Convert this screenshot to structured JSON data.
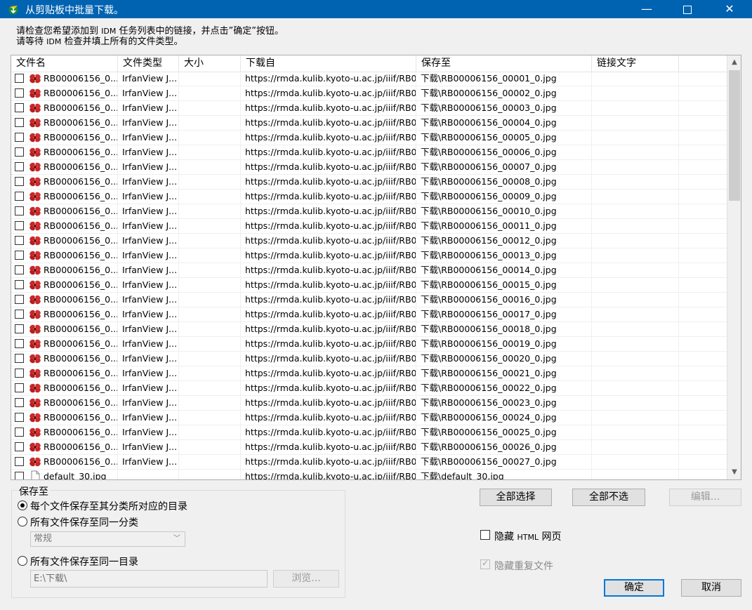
{
  "window": {
    "title": "从剪贴板中批量下载。",
    "minimize_glyph": "—",
    "close_glyph": "✕"
  },
  "instructions": {
    "line1_prefix": "请检查您希望添加到 ",
    "line1_idm": "IDM",
    "line1_suffix": " 任务列表中的链接，并点击”确定”按钮。",
    "line2_prefix": "请等待 ",
    "line2_idm": "IDM",
    "line2_suffix": " 检查并填上所有的文件类型。"
  },
  "table": {
    "columns": [
      "文件名",
      "文件类型",
      "大小",
      "下载自",
      "保存至",
      "链接文字"
    ],
    "rows": [
      {
        "name": "RB00006156_0...",
        "type": "IrfanView J...",
        "url": "https://rmda.kulib.kyoto-u.ac.jp/iiif/RB0...",
        "save": "下载\\RB00006156_00001_0.jpg"
      },
      {
        "name": "RB00006156_0...",
        "type": "IrfanView J...",
        "url": "https://rmda.kulib.kyoto-u.ac.jp/iiif/RB0...",
        "save": "下载\\RB00006156_00002_0.jpg"
      },
      {
        "name": "RB00006156_0...",
        "type": "IrfanView J...",
        "url": "https://rmda.kulib.kyoto-u.ac.jp/iiif/RB0...",
        "save": "下载\\RB00006156_00003_0.jpg"
      },
      {
        "name": "RB00006156_0...",
        "type": "IrfanView J...",
        "url": "https://rmda.kulib.kyoto-u.ac.jp/iiif/RB0...",
        "save": "下载\\RB00006156_00004_0.jpg"
      },
      {
        "name": "RB00006156_0...",
        "type": "IrfanView J...",
        "url": "https://rmda.kulib.kyoto-u.ac.jp/iiif/RB0...",
        "save": "下载\\RB00006156_00005_0.jpg"
      },
      {
        "name": "RB00006156_0...",
        "type": "IrfanView J...",
        "url": "https://rmda.kulib.kyoto-u.ac.jp/iiif/RB0...",
        "save": "下载\\RB00006156_00006_0.jpg"
      },
      {
        "name": "RB00006156_0...",
        "type": "IrfanView J...",
        "url": "https://rmda.kulib.kyoto-u.ac.jp/iiif/RB0...",
        "save": "下载\\RB00006156_00007_0.jpg"
      },
      {
        "name": "RB00006156_0...",
        "type": "IrfanView J...",
        "url": "https://rmda.kulib.kyoto-u.ac.jp/iiif/RB0...",
        "save": "下载\\RB00006156_00008_0.jpg"
      },
      {
        "name": "RB00006156_0...",
        "type": "IrfanView J...",
        "url": "https://rmda.kulib.kyoto-u.ac.jp/iiif/RB0...",
        "save": "下载\\RB00006156_00009_0.jpg"
      },
      {
        "name": "RB00006156_0...",
        "type": "IrfanView J...",
        "url": "https://rmda.kulib.kyoto-u.ac.jp/iiif/RB0...",
        "save": "下载\\RB00006156_00010_0.jpg"
      },
      {
        "name": "RB00006156_0...",
        "type": "IrfanView J...",
        "url": "https://rmda.kulib.kyoto-u.ac.jp/iiif/RB0...",
        "save": "下载\\RB00006156_00011_0.jpg"
      },
      {
        "name": "RB00006156_0...",
        "type": "IrfanView J...",
        "url": "https://rmda.kulib.kyoto-u.ac.jp/iiif/RB0...",
        "save": "下载\\RB00006156_00012_0.jpg"
      },
      {
        "name": "RB00006156_0...",
        "type": "IrfanView J...",
        "url": "https://rmda.kulib.kyoto-u.ac.jp/iiif/RB0...",
        "save": "下载\\RB00006156_00013_0.jpg"
      },
      {
        "name": "RB00006156_0...",
        "type": "IrfanView J...",
        "url": "https://rmda.kulib.kyoto-u.ac.jp/iiif/RB0...",
        "save": "下载\\RB00006156_00014_0.jpg"
      },
      {
        "name": "RB00006156_0...",
        "type": "IrfanView J...",
        "url": "https://rmda.kulib.kyoto-u.ac.jp/iiif/RB0...",
        "save": "下载\\RB00006156_00015_0.jpg"
      },
      {
        "name": "RB00006156_0...",
        "type": "IrfanView J...",
        "url": "https://rmda.kulib.kyoto-u.ac.jp/iiif/RB0...",
        "save": "下载\\RB00006156_00016_0.jpg"
      },
      {
        "name": "RB00006156_0...",
        "type": "IrfanView J...",
        "url": "https://rmda.kulib.kyoto-u.ac.jp/iiif/RB0...",
        "save": "下载\\RB00006156_00017_0.jpg"
      },
      {
        "name": "RB00006156_0...",
        "type": "IrfanView J...",
        "url": "https://rmda.kulib.kyoto-u.ac.jp/iiif/RB0...",
        "save": "下载\\RB00006156_00018_0.jpg"
      },
      {
        "name": "RB00006156_0...",
        "type": "IrfanView J...",
        "url": "https://rmda.kulib.kyoto-u.ac.jp/iiif/RB0...",
        "save": "下载\\RB00006156_00019_0.jpg"
      },
      {
        "name": "RB00006156_0...",
        "type": "IrfanView J...",
        "url": "https://rmda.kulib.kyoto-u.ac.jp/iiif/RB0...",
        "save": "下载\\RB00006156_00020_0.jpg"
      },
      {
        "name": "RB00006156_0...",
        "type": "IrfanView J...",
        "url": "https://rmda.kulib.kyoto-u.ac.jp/iiif/RB0...",
        "save": "下载\\RB00006156_00021_0.jpg"
      },
      {
        "name": "RB00006156_0...",
        "type": "IrfanView J...",
        "url": "https://rmda.kulib.kyoto-u.ac.jp/iiif/RB0...",
        "save": "下载\\RB00006156_00022_0.jpg"
      },
      {
        "name": "RB00006156_0...",
        "type": "IrfanView J...",
        "url": "https://rmda.kulib.kyoto-u.ac.jp/iiif/RB0...",
        "save": "下载\\RB00006156_00023_0.jpg"
      },
      {
        "name": "RB00006156_0...",
        "type": "IrfanView J...",
        "url": "https://rmda.kulib.kyoto-u.ac.jp/iiif/RB0...",
        "save": "下载\\RB00006156_00024_0.jpg"
      },
      {
        "name": "RB00006156_0...",
        "type": "IrfanView J...",
        "url": "https://rmda.kulib.kyoto-u.ac.jp/iiif/RB0...",
        "save": "下载\\RB00006156_00025_0.jpg"
      },
      {
        "name": "RB00006156_0...",
        "type": "IrfanView J...",
        "url": "https://rmda.kulib.kyoto-u.ac.jp/iiif/RB0...",
        "save": "下载\\RB00006156_00026_0.jpg"
      },
      {
        "name": "RB00006156_0...",
        "type": "IrfanView J...",
        "url": "https://rmda.kulib.kyoto-u.ac.jp/iiif/RB0...",
        "save": "下载\\RB00006156_00027_0.jpg"
      },
      {
        "name": "default_30.jpg",
        "type": "",
        "url": "https://rmda.kulib.kyoto-u.ac.jp/iiif/RB0...",
        "save": "下载\\default_30.jpg",
        "icon": "blank-file-icon"
      }
    ]
  },
  "save_group": {
    "legend": "保存至",
    "option1": "每个文件保存至其分类所对应的目录",
    "option2": "所有文件保存至同一分类",
    "category_value": "常规",
    "option3": "所有文件保存至同一目录",
    "path_value": "E:\\下载\\",
    "browse_label": "浏览..."
  },
  "buttons": {
    "select_all": "全部选择",
    "deselect_all": "全部不选",
    "edit": "编辑...",
    "ok": "确定",
    "cancel": "取消"
  },
  "checks": {
    "hide_html_prefix": "隐藏 ",
    "hide_html_mid": "HTML",
    "hide_html_suffix": " 网页",
    "hide_dup": "隐藏重复文件"
  },
  "icons": {
    "row_file_icon": "irfanview-icon",
    "app_icon": "idm-icon"
  }
}
